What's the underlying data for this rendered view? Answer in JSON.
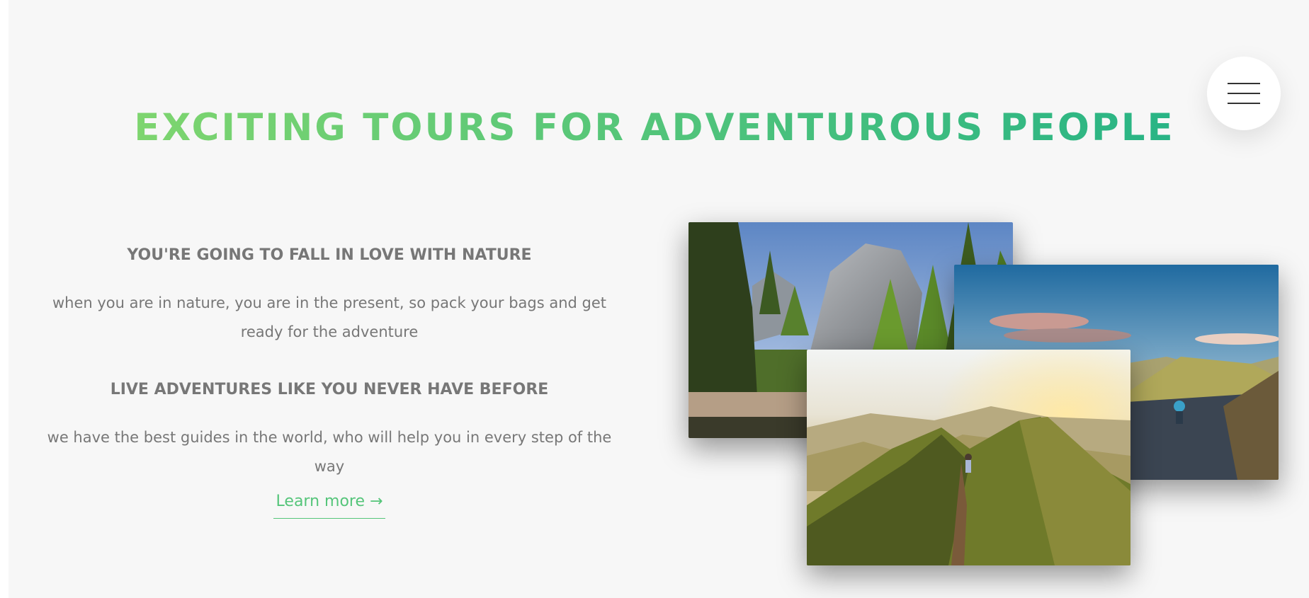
{
  "header": {
    "title": "EXCITING TOURS FOR ADVENTUROUS PEOPLE",
    "menu_icon": "hamburger-menu-icon"
  },
  "about": {
    "heading_1": "YOU'RE GOING TO FALL IN LOVE WITH NATURE",
    "text_1": "when you are in nature, you are in the present, so pack your bags and get ready for the adventure",
    "heading_2": "LIVE ADVENTURES LIKE YOU NEVER HAVE BEFORE",
    "text_2": "we have the best guides in the world, who will help you in every step of the way",
    "link_label": "Learn more →"
  },
  "colors": {
    "accent": "#55c57a",
    "gradient_start": "#7ed56f",
    "gradient_end": "#28b485",
    "text": "#777777",
    "background": "#f7f7f7"
  }
}
